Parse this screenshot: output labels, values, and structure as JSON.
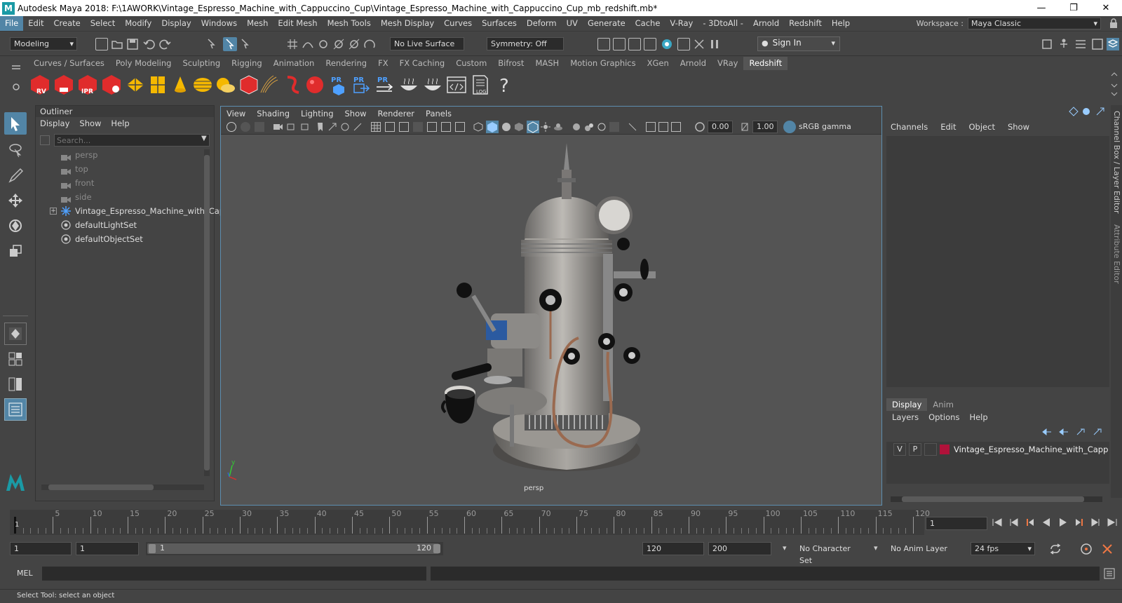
{
  "window": {
    "title": "Autodesk Maya 2018: F:\\1AWORK\\Vintage_Espresso_Machine_with_Cappuccino_Cup\\Vintage_Espresso_Machine_with_Cappuccino_Cup_mb_redshift.mb*",
    "logo": "M"
  },
  "menubar": {
    "items": [
      "File",
      "Edit",
      "Create",
      "Select",
      "Modify",
      "Display",
      "Windows",
      "Mesh",
      "Edit Mesh",
      "Mesh Tools",
      "Mesh Display",
      "Curves",
      "Surfaces",
      "Deform",
      "UV",
      "Generate",
      "Cache",
      "V-Ray",
      "- 3DtoAll -",
      "Arnold",
      "Redshift",
      "Help"
    ],
    "workspace_label": "Workspace :",
    "workspace_value": "Maya Classic"
  },
  "statusline": {
    "mode": "Modeling",
    "live_surface": "No Live Surface",
    "symmetry": "Symmetry: Off",
    "sign_in": "Sign In"
  },
  "shelf": {
    "tabs": [
      "Curves / Surfaces",
      "Poly Modeling",
      "Sculpting",
      "Rigging",
      "Animation",
      "Rendering",
      "FX",
      "FX Caching",
      "Custom",
      "Bifrost",
      "MASH",
      "Motion Graphics",
      "XGen",
      "Arnold",
      "VRay",
      "Redshift"
    ],
    "active_tab": "Redshift",
    "icon_labels": {
      "rv": "RV",
      "ipr": "IPR",
      "pr": "PR",
      "log": "LOG"
    }
  },
  "outliner": {
    "title": "Outliner",
    "menu": [
      "Display",
      "Show",
      "Help"
    ],
    "search_placeholder": "Search...",
    "items": [
      {
        "label": "persp",
        "type": "camera"
      },
      {
        "label": "top",
        "type": "camera"
      },
      {
        "label": "front",
        "type": "camera"
      },
      {
        "label": "side",
        "type": "camera"
      },
      {
        "label": "Vintage_Espresso_Machine_with_Cap",
        "type": "group"
      },
      {
        "label": "defaultLightSet",
        "type": "set"
      },
      {
        "label": "defaultObjectSet",
        "type": "set"
      }
    ]
  },
  "viewport": {
    "menu": [
      "View",
      "Shading",
      "Lighting",
      "Show",
      "Renderer",
      "Panels"
    ],
    "exposure": "0.00",
    "gamma": "1.00",
    "color_space": "sRGB gamma",
    "camera_label": "persp",
    "axis_y": "y"
  },
  "channelbox": {
    "menu": [
      "Channels",
      "Edit",
      "Object",
      "Show"
    ],
    "side_tabs": [
      "Channel Box / Layer Editor",
      "Attribute Editor"
    ]
  },
  "layereditor": {
    "tabs": [
      "Display",
      "Anim"
    ],
    "menu": [
      "Layers",
      "Options",
      "Help"
    ],
    "layer": {
      "v": "V",
      "p": "P",
      "name": "Vintage_Espresso_Machine_with_Cappuccir",
      "color": "#b0123a"
    }
  },
  "timeslider": {
    "ticks": [
      "5",
      "10",
      "15",
      "20",
      "25",
      "30",
      "35",
      "40",
      "45",
      "50",
      "55",
      "60",
      "65",
      "70",
      "75",
      "80",
      "85",
      "90",
      "95",
      "100",
      "105",
      "110",
      "115",
      "120"
    ],
    "start_marker": "1",
    "current_frame": "1"
  },
  "range": {
    "start": "1",
    "playback_start": "1",
    "slider_start": "1",
    "slider_end": "120",
    "playback_end": "120",
    "end": "200",
    "character_set": "No Character Set",
    "anim_layer": "No Anim Layer",
    "fps": "24 fps"
  },
  "commandline": {
    "label": "MEL"
  },
  "helpline": {
    "text": "Select Tool: select an object"
  },
  "colors": {
    "accent": "#5285a6",
    "maya_teal": "#1a9aa5",
    "redshift_red": "#e02c2c"
  }
}
